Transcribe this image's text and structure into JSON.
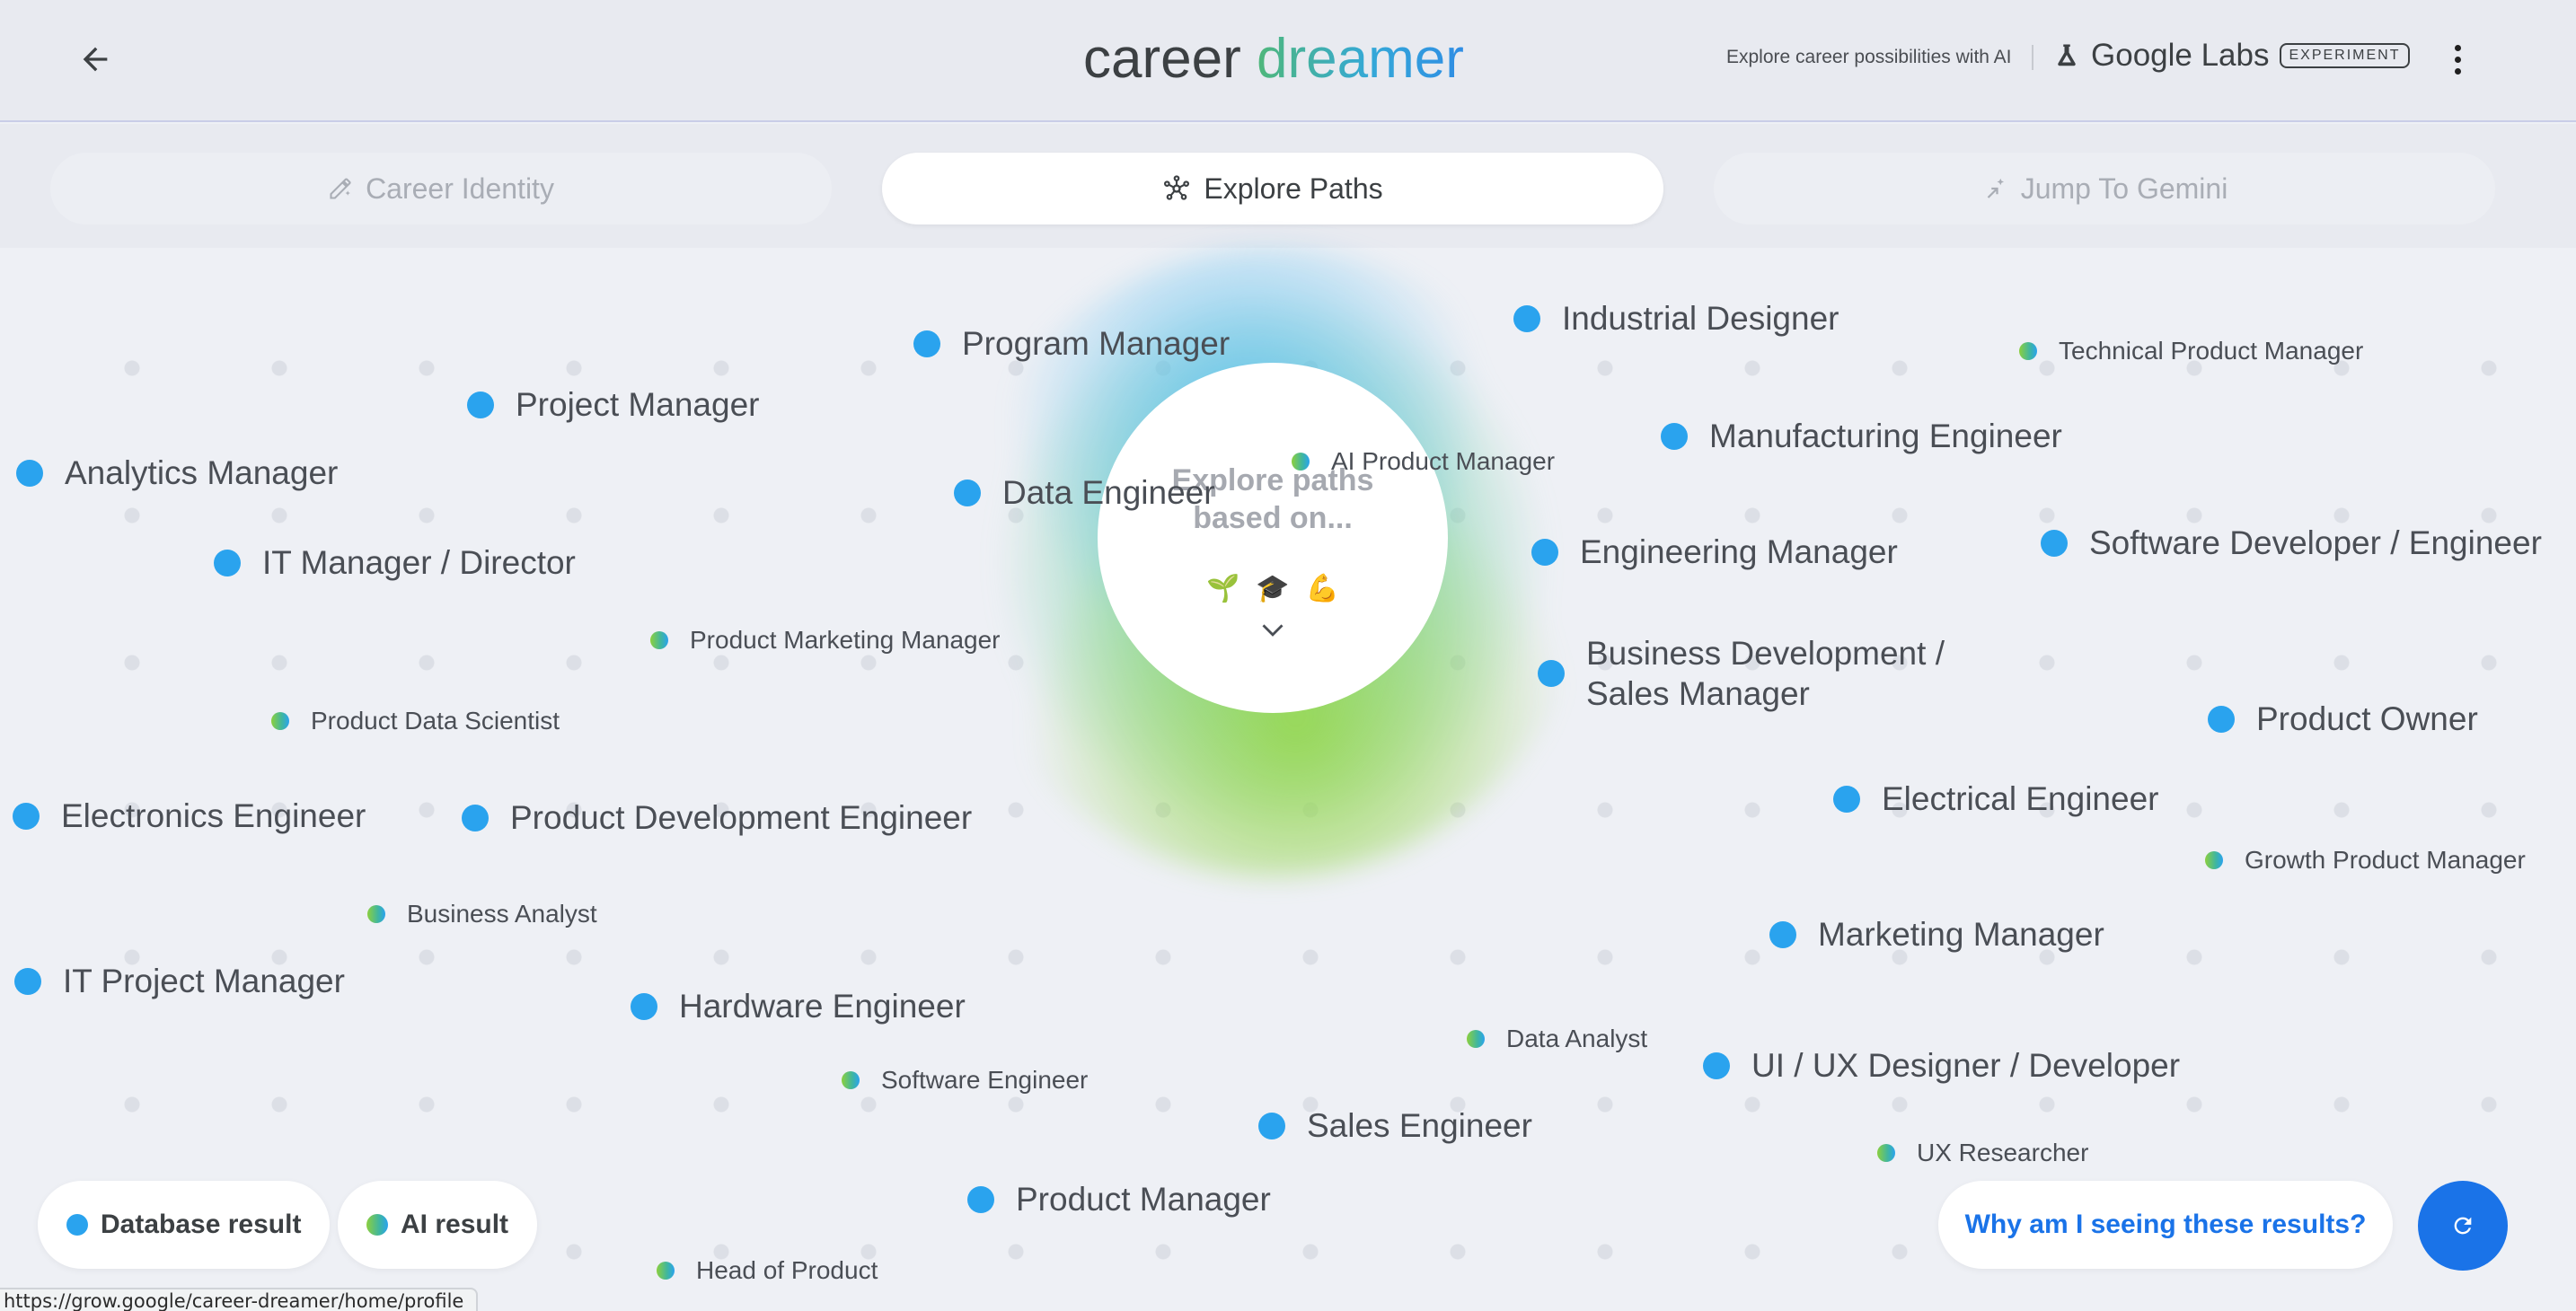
{
  "header": {
    "back_label": "",
    "logo_word1": "career",
    "logo_word2": "dreamer",
    "tagline": "Explore career possibilities with AI",
    "labs_name": "Google Labs",
    "experiment_badge": "EXPERIMENT"
  },
  "tabs": [
    {
      "label": "Career Identity",
      "icon": "pencil-sparkle-icon",
      "state": "inactive"
    },
    {
      "label": "Explore Paths",
      "icon": "network-icon",
      "state": "active"
    },
    {
      "label": "Jump To Gemini",
      "icon": "sparkle-arrow-icon",
      "state": "inactive"
    }
  ],
  "center": {
    "title": "Explore paths based on...",
    "emojis": [
      "🌱",
      "🎓",
      "💪"
    ]
  },
  "nodes": [
    {
      "label": "Program Manager",
      "kind": "db"
    },
    {
      "label": "Industrial Designer",
      "kind": "db"
    },
    {
      "label": "Technical Product Manager",
      "kind": "ai"
    },
    {
      "label": "Project Manager",
      "kind": "db"
    },
    {
      "label": "AI Product Manager",
      "kind": "ai"
    },
    {
      "label": "Manufacturing Engineer",
      "kind": "db"
    },
    {
      "label": "Analytics Manager",
      "kind": "db"
    },
    {
      "label": "Data Engineer",
      "kind": "db"
    },
    {
      "label": "Engineering Manager",
      "kind": "db"
    },
    {
      "label": "Software Developer / Engineer",
      "kind": "db"
    },
    {
      "label": "IT Manager / Director",
      "kind": "db"
    },
    {
      "label": "Product Marketing Manager",
      "kind": "ai"
    },
    {
      "label": "Business Development / Sales Manager",
      "kind": "db"
    },
    {
      "label": "Product Data Scientist",
      "kind": "ai"
    },
    {
      "label": "Product Owner",
      "kind": "db"
    },
    {
      "label": "Electronics Engineer",
      "kind": "db"
    },
    {
      "label": "Product Development Engineer",
      "kind": "db"
    },
    {
      "label": "Electrical Engineer",
      "kind": "db"
    },
    {
      "label": "Growth Product Manager",
      "kind": "ai"
    },
    {
      "label": "Business Analyst",
      "kind": "ai"
    },
    {
      "label": "Marketing Manager",
      "kind": "db"
    },
    {
      "label": "IT Project Manager",
      "kind": "db"
    },
    {
      "label": "Hardware Engineer",
      "kind": "db"
    },
    {
      "label": "Data Analyst",
      "kind": "ai"
    },
    {
      "label": "Software Engineer",
      "kind": "ai"
    },
    {
      "label": "UI / UX Designer / Developer",
      "kind": "db"
    },
    {
      "label": "Sales Engineer",
      "kind": "db"
    },
    {
      "label": "UX Researcher",
      "kind": "ai"
    },
    {
      "label": "Product Manager",
      "kind": "db"
    },
    {
      "label": "Head of Product",
      "kind": "ai"
    }
  ],
  "legend": {
    "database_label": "Database result",
    "ai_label": "AI result"
  },
  "why_button": "Why am I seeing these results?",
  "status_url": "https://grow.google/career-dreamer/home/profile",
  "colors": {
    "db_dot": "#2aa3ee",
    "ai_dot_start": "#8ccf3e",
    "ai_dot_end": "#2aa3ee",
    "accent": "#1a73e8"
  }
}
